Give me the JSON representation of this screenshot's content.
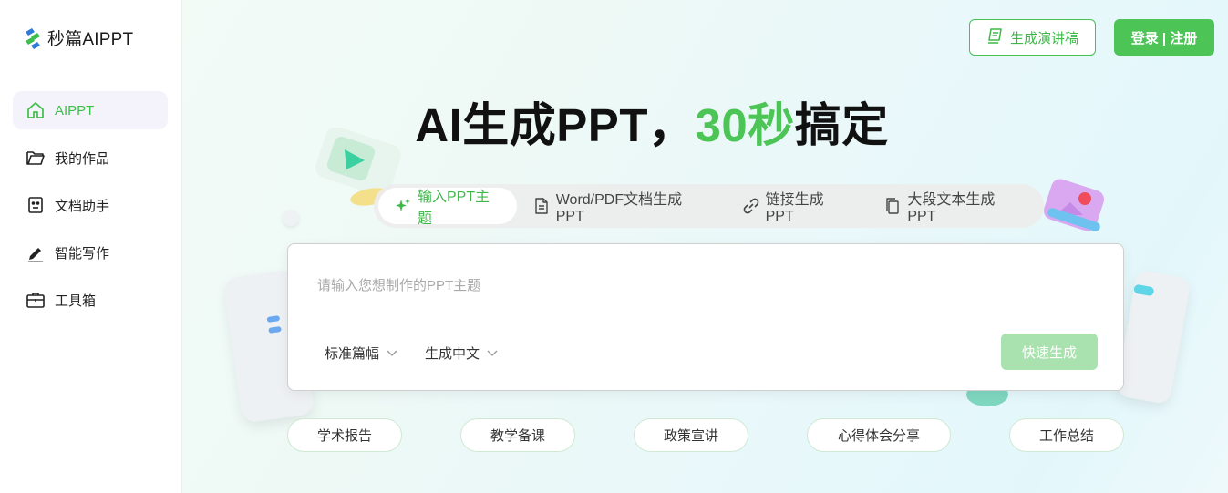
{
  "brand": {
    "name": "秒篇AIPPT"
  },
  "sidebar": {
    "items": [
      {
        "label": "AIPPT",
        "icon": "home-icon",
        "active": true
      },
      {
        "label": "我的作品",
        "icon": "folder-icon",
        "active": false
      },
      {
        "label": "文档助手",
        "icon": "robot-icon",
        "active": false
      },
      {
        "label": "智能写作",
        "icon": "pen-icon",
        "active": false
      },
      {
        "label": "工具箱",
        "icon": "toolbox-icon",
        "active": false
      }
    ]
  },
  "header": {
    "speech_button": "生成演讲稿",
    "login_button": "登录 | 注册"
  },
  "hero": {
    "part1": "AI生成PPT，",
    "accent": "30秒",
    "part2": "搞定"
  },
  "tabs": [
    {
      "label": "输入PPT主题",
      "icon": "sparkle-icon",
      "active": true
    },
    {
      "label": "Word/PDF文档生成PPT",
      "icon": "document-icon",
      "active": false
    },
    {
      "label": "链接生成PPT",
      "icon": "link-icon",
      "active": false
    },
    {
      "label": "大段文本生成PPT",
      "icon": "copy-icon",
      "active": false
    }
  ],
  "input": {
    "placeholder": "请输入您想制作的PPT主题",
    "length_option": "标准篇幅",
    "language_option": "生成中文",
    "generate_button": "快速生成"
  },
  "chips": [
    "学术报告",
    "教学备课",
    "政策宣讲",
    "心得体会分享",
    "工作总结"
  ],
  "colors": {
    "accent": "#4cc556",
    "accent_light": "#a9e2ae",
    "active_nav_bg": "#f4f2fb"
  }
}
